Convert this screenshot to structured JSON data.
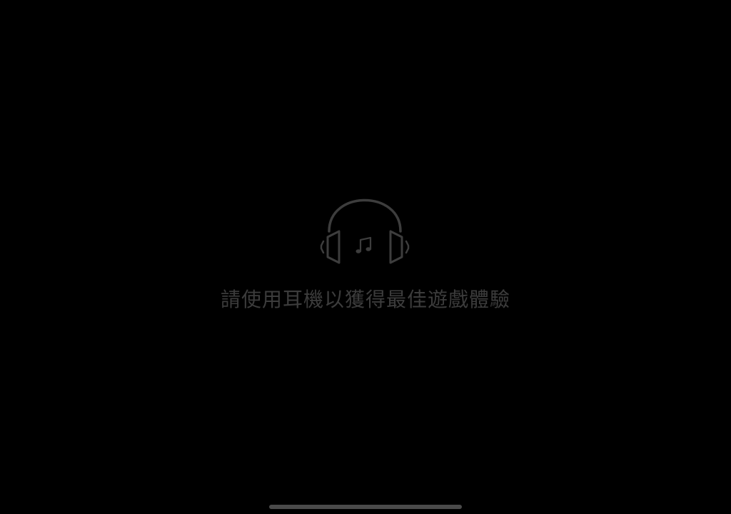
{
  "screen": {
    "message": "請使用耳機以獲得最佳遊戲體驗",
    "icon": "headphones-icon",
    "music_icon": "music-note-icon"
  },
  "colors": {
    "background": "#000000",
    "icon_stroke": "#3d3d3d",
    "text": "#3c3c3c",
    "home_indicator": "#4a4a4a"
  }
}
